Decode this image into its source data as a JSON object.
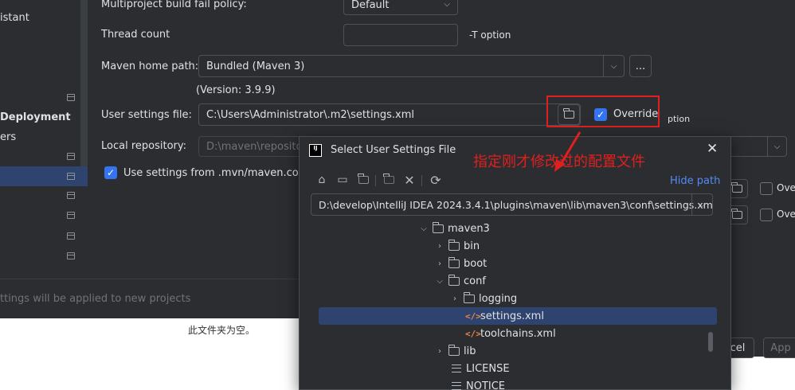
{
  "nav": {
    "items": [
      {
        "label": "istant"
      },
      {
        "label": "Deployment"
      },
      {
        "label": "ers"
      }
    ]
  },
  "settings": {
    "fail_policy_label": "Multiproject build fail policy:",
    "fail_policy_value": "Default",
    "thread_count_label": "Thread count",
    "thread_count_value": "",
    "thread_count_hint": "-T option",
    "maven_home_label": "Maven home path:",
    "maven_home_value": "Bundled (Maven 3)",
    "maven_home_browse": "...",
    "maven_version": "(Version: 3.9.9)",
    "user_settings_label": "User settings file:",
    "user_settings_value": "C:\\Users\\Administrator\\.m2\\settings.xml",
    "override_label": "Override",
    "option_hint": "ption",
    "local_repo_label": "Local repository:",
    "local_repo_value": "D:\\maven\\repository",
    "mvn_config_label": "Use settings from .mvn/maven.config",
    "bottom_hint": "ttings will be applied to new projects",
    "right_checkbox_label": "Ove",
    "cancel_label": "cel",
    "apply_label": "App"
  },
  "empty_folder_msg": "此文件夹为空。",
  "annotation": "指定刚才修改过的配置文件",
  "dialog": {
    "title": "Select User Settings File",
    "hide_path": "Hide path",
    "path_value": "D:\\develop\\IntelliJ IDEA 2024.3.4.1\\plugins\\maven\\lib\\maven3\\conf\\settings.xml",
    "tree": [
      {
        "label": "maven3"
      },
      {
        "label": "bin"
      },
      {
        "label": "boot"
      },
      {
        "label": "conf"
      },
      {
        "label": "logging"
      },
      {
        "label": "settings.xml"
      },
      {
        "label": "toolchains.xml"
      },
      {
        "label": "lib"
      },
      {
        "label": "LICENSE"
      },
      {
        "label": "NOTICE"
      }
    ]
  }
}
